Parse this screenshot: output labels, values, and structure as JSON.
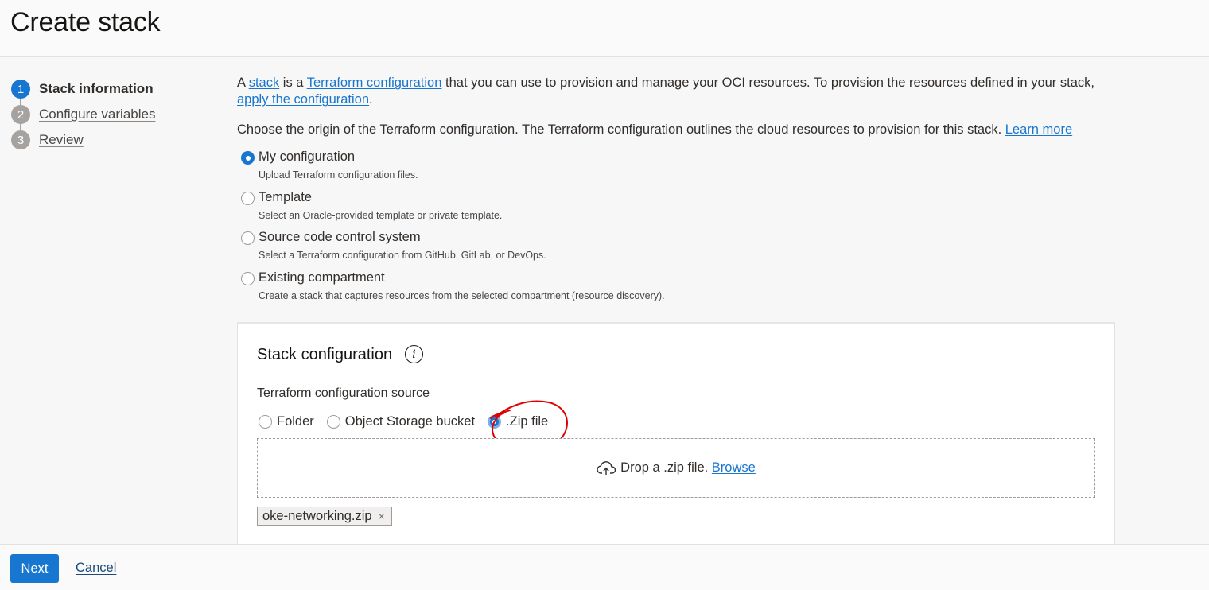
{
  "header": {
    "title": "Create stack"
  },
  "steps": [
    {
      "num": "1",
      "label": "Stack information",
      "active": true
    },
    {
      "num": "2",
      "label": "Configure variables",
      "active": false
    },
    {
      "num": "3",
      "label": "Review",
      "active": false
    }
  ],
  "intro": {
    "p1_a": "A ",
    "link_stack": "stack",
    "p1_b": " is a ",
    "link_terraform": "Terraform configuration",
    "p1_c": " that you can use to provision and manage your OCI resources. To provision the resources defined in your stack, ",
    "link_apply": "apply the configuration",
    "p1_d": ".",
    "p2": "Choose the origin of the Terraform configuration. The Terraform configuration outlines the cloud resources to provision for this stack. ",
    "link_learn": "Learn more"
  },
  "origins": [
    {
      "title": "My configuration",
      "desc": "Upload Terraform configuration files.",
      "checked": true
    },
    {
      "title": "Template",
      "desc": "Select an Oracle-provided template or private template.",
      "checked": false
    },
    {
      "title": "Source code control system",
      "desc": "Select a Terraform configuration from GitHub, GitLab, or DevOps.",
      "checked": false
    },
    {
      "title": "Existing compartment",
      "desc": "Create a stack that captures resources from the selected compartment (resource discovery).",
      "checked": false
    }
  ],
  "config": {
    "title": "Stack configuration",
    "info_icon": "i",
    "source_label": "Terraform configuration source",
    "sources": [
      {
        "label": "Folder",
        "checked": false
      },
      {
        "label": "Object Storage bucket",
        "checked": false
      },
      {
        "label": ".Zip file",
        "checked": true
      }
    ],
    "drop_text": "Drop a .zip file. ",
    "browse_label": "Browse",
    "file_chip": "oke-networking.zip",
    "remove_glyph": "×"
  },
  "footer": {
    "next_label": "Next",
    "cancel_label": "Cancel"
  },
  "colors": {
    "accent": "#1776cf",
    "annotation": "#e00000"
  }
}
